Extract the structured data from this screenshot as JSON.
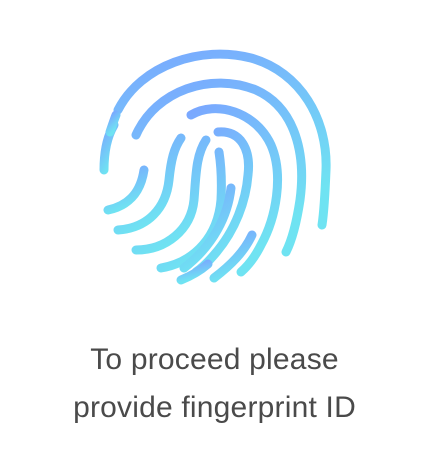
{
  "fingerprint": {
    "icon": "fingerprint-icon",
    "gradient_top": "#7aa7ff",
    "gradient_bottom": "#6fe3f2"
  },
  "prompt": {
    "line1": "To proceed please",
    "line2": "provide fingerprint ID",
    "color": "#4a4a4a"
  }
}
